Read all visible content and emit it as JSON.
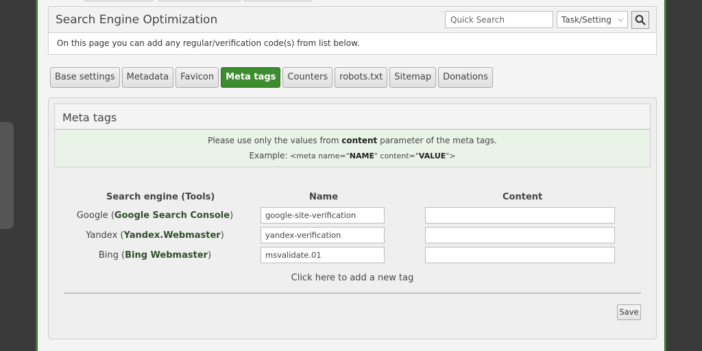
{
  "header": {
    "title": "Search Engine Optimization",
    "description": "On this page you can add any regular/verification code(s) from list below.",
    "search_placeholder": "Quick Search",
    "select_value": "Task/Setting",
    "search_icon": "magnifier-icon"
  },
  "tabs": [
    {
      "label": "Base settings",
      "active": false
    },
    {
      "label": "Metadata",
      "active": false
    },
    {
      "label": "Favicon",
      "active": false
    },
    {
      "label": "Meta tags",
      "active": true
    },
    {
      "label": "Counters",
      "active": false
    },
    {
      "label": "robots.txt",
      "active": false
    },
    {
      "label": "Sitemap",
      "active": false
    },
    {
      "label": "Donations",
      "active": false
    }
  ],
  "meta_tags": {
    "title": "Meta tags",
    "info_prefix": "Please use only the values from",
    "info_bold": "content",
    "info_suffix": "parameter of the meta tags.",
    "example_label": "Example:",
    "example_1": "<meta name=\"",
    "example_name": "NAME",
    "example_2": "\" content=\"",
    "example_value": "VALUE",
    "example_3": "\">",
    "columns": {
      "engine": "Search engine (Tools)",
      "name": "Name",
      "content": "Content"
    },
    "rows": [
      {
        "engine": "Google",
        "tool": "Google Search Console",
        "name": "google-site-verification",
        "content": ""
      },
      {
        "engine": "Yandex",
        "tool": "Yandex.Webmaster",
        "name": "yandex-verification",
        "content": ""
      },
      {
        "engine": "Bing",
        "tool": "Bing Webmaster",
        "name": "msvalidate.01",
        "content": ""
      }
    ],
    "add_tag": "Click here to add a new tag",
    "save_label": "Save"
  },
  "colors": {
    "accent": "#3d8c2f",
    "info_bg": "#eaf3e7"
  }
}
